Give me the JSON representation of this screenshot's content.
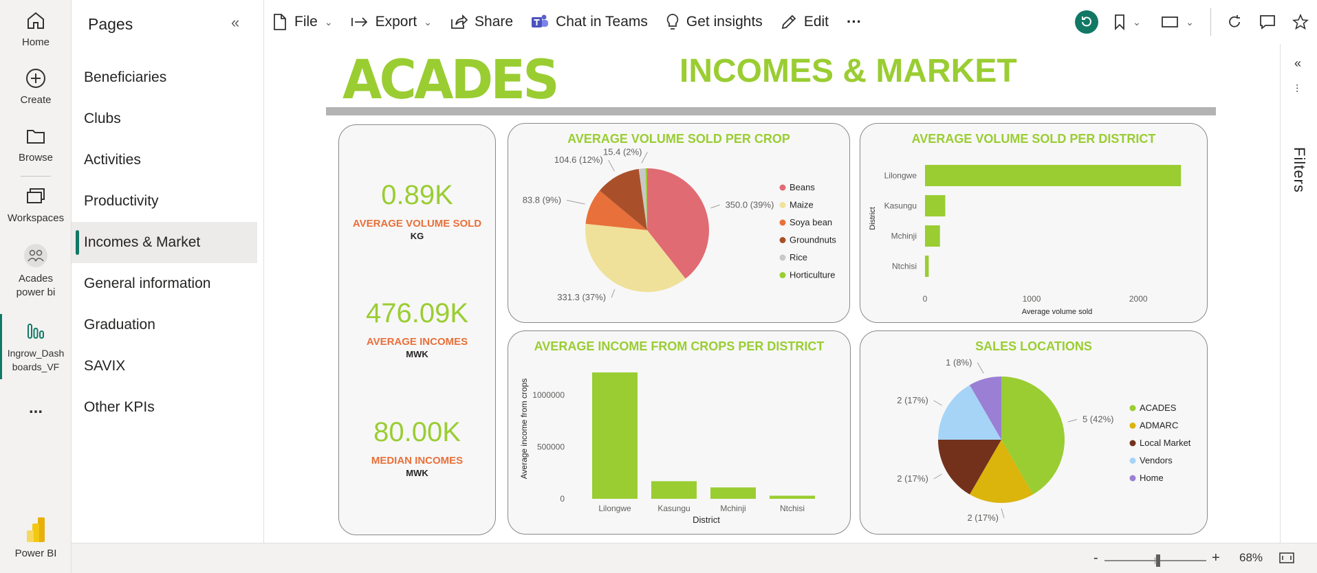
{
  "nav_rail": {
    "items": [
      {
        "label": "Home",
        "icon": "home-icon"
      },
      {
        "label": "Create",
        "icon": "plus-circle-icon"
      },
      {
        "label": "Browse",
        "icon": "folder-icon"
      },
      {
        "label": "Workspaces",
        "icon": "workspaces-icon"
      },
      {
        "label": "Acades power bi",
        "icon": "people-icon"
      },
      {
        "label": "Ingrow_Dashboards_VF",
        "icon": "report-icon"
      },
      {
        "label": "...",
        "icon": "more-icon"
      },
      {
        "label": "Power BI",
        "icon": "powerbi-logo"
      }
    ]
  },
  "pages": {
    "title": "Pages",
    "items": [
      "Beneficiaries",
      "Clubs",
      "Activities",
      "Productivity",
      "Incomes & Market",
      "General information",
      "Graduation",
      "SAVIX",
      "Other KPIs"
    ],
    "active_index": 4
  },
  "toolbar": {
    "file": "File",
    "export": "Export",
    "share": "Share",
    "chat": "Chat in Teams",
    "insights": "Get insights",
    "edit": "Edit",
    "more": "···"
  },
  "report": {
    "logo_text": "ACADES",
    "title": "INCOMES & MARKET",
    "accent": "#9acd32",
    "label_color": "#e8703a"
  },
  "kpis": [
    {
      "value": "0.89K",
      "label": "AVERAGE VOLUME SOLD",
      "unit": "KG"
    },
    {
      "value": "476.09K",
      "label": "AVERAGE INCOMES",
      "unit": "MWK"
    },
    {
      "value": "80.00K",
      "label": "MEDIAN INCOMES",
      "unit": "MWK"
    }
  ],
  "filters": {
    "label": "Filters"
  },
  "status": {
    "zoom": "68%",
    "minus": "-",
    "plus": "+",
    "zoom_fraction": 0.53
  },
  "chart_data": [
    {
      "type": "pie",
      "title": "AVERAGE VOLUME SOLD PER CROP",
      "labels": [
        "Beans",
        "Maize",
        "Soya bean",
        "Groundnuts",
        "Rice",
        "Horticulture"
      ],
      "values": [
        350.0,
        331.3,
        83.8,
        104.6,
        15.4,
        4
      ],
      "data_labels": [
        "350.0 (39%)",
        "331.3 (37%)",
        "83.8 (9%)",
        "104.6 (12%)",
        "15.4 (2%)",
        ""
      ],
      "colors": [
        "#e06b73",
        "#efe19a",
        "#e8703a",
        "#a9502a",
        "#c8c8c8",
        "#9acd32"
      ],
      "legend": "right"
    },
    {
      "type": "bar",
      "orientation": "horizontal",
      "title": "AVERAGE VOLUME SOLD PER DISTRICT",
      "categories": [
        "Lilongwe",
        "Kasungu",
        "Mchinji",
        "Ntchisi"
      ],
      "values": [
        2400,
        190,
        140,
        35
      ],
      "xlabel": "Average volume sold",
      "ylabel": "District",
      "xlim": [
        0,
        2450
      ],
      "ticks": [
        0,
        1000,
        2000
      ],
      "color": "#9acd32"
    },
    {
      "type": "bar",
      "title": "AVERAGE INCOME FROM CROPS PER DISTRICT",
      "categories": [
        "Lilongwe",
        "Kasungu",
        "Mchinji",
        "Ntchisi"
      ],
      "values": [
        1220000,
        170000,
        110000,
        30000
      ],
      "xlabel": "District",
      "ylabel": "Average income from crops",
      "ylim": [
        0,
        1300000
      ],
      "ticks": [
        0,
        500000,
        1000000
      ],
      "color": "#9acd32"
    },
    {
      "type": "pie",
      "title": "SALES LOCATIONS",
      "labels": [
        "ACADES",
        "ADMARC",
        "Local Market",
        "Vendors",
        "Home"
      ],
      "values": [
        5,
        2,
        2,
        2,
        1
      ],
      "data_labels": [
        "5 (42%)",
        "2 (17%)",
        "2 (17%)",
        "2 (17%)",
        "1 (8%)"
      ],
      "colors": [
        "#9acd32",
        "#dbb40c",
        "#73311c",
        "#a5d4f7",
        "#9b7fd4"
      ],
      "legend": "right"
    }
  ]
}
